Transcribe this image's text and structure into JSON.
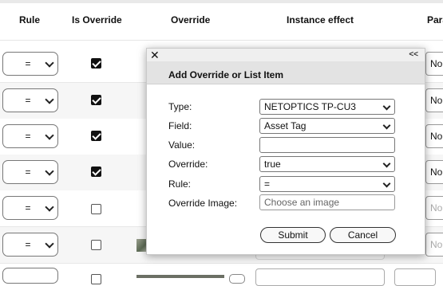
{
  "table": {
    "headers": {
      "rule": "Rule",
      "is_override": "Is Override",
      "override": "Override",
      "instance_effect": "Instance effect",
      "par": "Para"
    },
    "rows": [
      {
        "rule": "=",
        "is_override": true,
        "par": "No"
      },
      {
        "rule": "=",
        "is_override": true,
        "par": "No"
      },
      {
        "rule": "=",
        "is_override": true,
        "par": "No"
      },
      {
        "rule": "=",
        "is_override": true,
        "par": "No"
      },
      {
        "rule": "=",
        "is_override": false,
        "par": "No"
      },
      {
        "rule": "=",
        "is_override": false,
        "par": "No"
      }
    ]
  },
  "dialog": {
    "close_glyph": "✕",
    "collapse_glyph": "<<",
    "title": "Add Override or List Item",
    "fields": {
      "type_label": "Type:",
      "type_value": "NETOPTICS TP-CU3",
      "field_label": "Field:",
      "field_value": "Asset Tag",
      "value_label": "Value:",
      "value_value": "",
      "override_label": "Override:",
      "override_value": "true",
      "rule_label": "Rule:",
      "rule_value": "=",
      "image_label": "Override Image:",
      "image_placeholder": "Choose an image"
    },
    "submit_label": "Submit",
    "cancel_label": "Cancel"
  }
}
